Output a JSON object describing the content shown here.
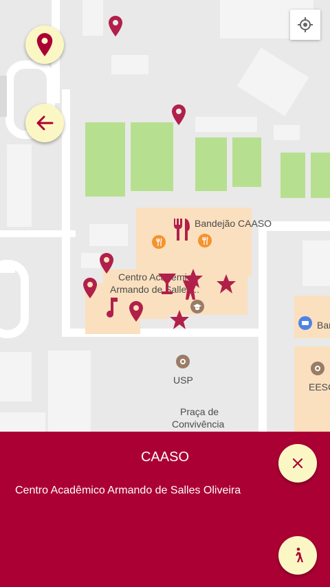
{
  "map": {
    "labels": {
      "bandejao": "Bandejão CAASO",
      "centro_line1": "Centro Acadêmico",
      "centro_line2": "Armando de Salles...",
      "usp": "USP",
      "praca_line1": "Praça de",
      "praca_line2": "Convivência",
      "bank": "Bar",
      "eesc": "EESC"
    },
    "icons": {
      "my_location": "my-location-icon",
      "back": "arrow-left-icon",
      "pin": "map-pin-icon"
    }
  },
  "panel": {
    "title": "CAASO",
    "subtitle": "Centro Acadêmico Armando de Salles Oliveira",
    "close_icon": "close-icon",
    "walk_icon": "walking-person-icon"
  },
  "colors": {
    "accent": "#ab0034",
    "fab_background": "#fbf7c4",
    "marker": "#b0204a"
  }
}
